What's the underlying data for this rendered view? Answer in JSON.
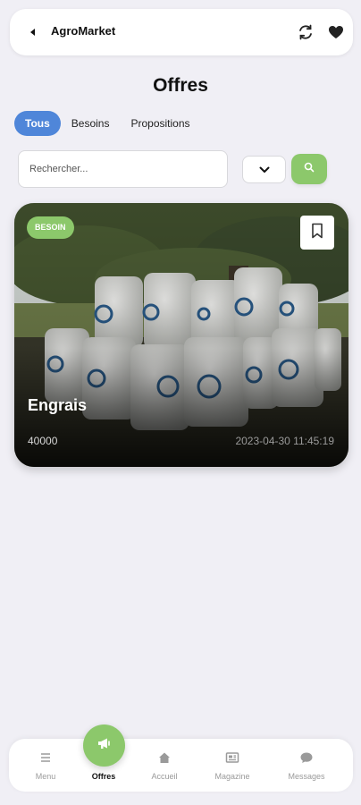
{
  "appbar": {
    "title": "AgroMarket",
    "icons": [
      "back-arrow-icon",
      "sync-icon",
      "heart-icon"
    ]
  },
  "page": {
    "title": "Offres"
  },
  "tabs": [
    {
      "label": "Tous",
      "active": true
    },
    {
      "label": "Besoins",
      "active": false
    },
    {
      "label": "Propositions",
      "active": false
    }
  ],
  "search": {
    "placeholder": "Rechercher...",
    "value": ""
  },
  "filter": {
    "icon": "chevron-down-icon"
  },
  "colors": {
    "accent_green": "#8cc86b",
    "tab_blue": "#4f86d9",
    "background": "#f0eff5"
  },
  "offers": [
    {
      "badge": "BESOIN",
      "title": "Engrais",
      "price": "40000",
      "date": "2023-04-30 11:45:19"
    }
  ],
  "nav": {
    "items": [
      {
        "label": "Menu",
        "icon": "menu-icon",
        "active": false
      },
      {
        "label": "Offres",
        "icon": "megaphone-icon",
        "active": true
      },
      {
        "label": "Accueil",
        "icon": "home-icon",
        "active": false
      },
      {
        "label": "Magazine",
        "icon": "newspaper-icon",
        "active": false
      },
      {
        "label": "Messages",
        "icon": "chat-bubble-icon",
        "active": false
      }
    ]
  }
}
